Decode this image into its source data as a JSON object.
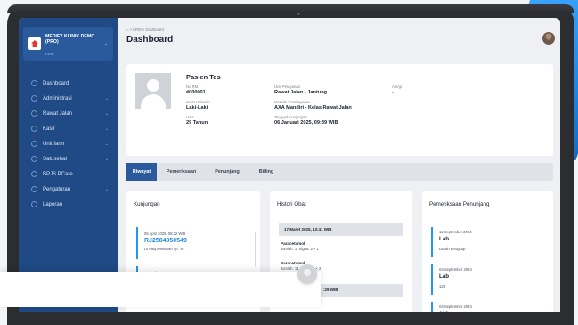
{
  "app": {
    "clinic_name": "MEDIFY KLINIK DEMO (PRO)",
    "clinic_sub": "Klinik"
  },
  "sidebar": {
    "items": [
      {
        "label": "Dashboard",
        "has_children": false
      },
      {
        "label": "Administrasi",
        "has_children": true
      },
      {
        "label": "Rawat Jalan",
        "has_children": true
      },
      {
        "label": "Kasir",
        "has_children": true
      },
      {
        "label": "Unit farm",
        "has_children": true
      },
      {
        "label": "Satusehat",
        "has_children": true
      },
      {
        "label": "BPJS PCare",
        "has_children": true
      },
      {
        "label": "Pengaturan",
        "has_children": true
      },
      {
        "label": "Laporan",
        "has_children": false
      }
    ]
  },
  "header": {
    "breadcrumb": "> ERM > Dashboard",
    "title": "Dashboard"
  },
  "patient": {
    "name": "Pasien Tes",
    "no_rm_label": "No RM",
    "no_rm": "#000001",
    "gender_label": "Jenis Kelamin",
    "gender": "Laki-Laki",
    "age_label": "Usia",
    "age": "29 Tahun",
    "unit_label": "Unit Pelayanan",
    "unit": "Rawat Jalan - Jantung",
    "payment_label": "Metode Pembayaran",
    "payment": "AXA Mandiri - Kelas Rawat Jalan",
    "visit_date_label": "Tanggal Kunjungan",
    "visit_date": "06 Januari 2025, 09:39 WIB",
    "allergy_label": "Alergi",
    "allergy": "-"
  },
  "tabs": [
    {
      "label": "Riwayat",
      "active": true
    },
    {
      "label": "Pemeriksaan",
      "active": false
    },
    {
      "label": "Penunjang",
      "active": false
    },
    {
      "label": "Billing",
      "active": false
    }
  ],
  "kunjungan": {
    "title": "Kunjungan",
    "items": [
      {
        "date": "05 April 2025, 08:22 WIB",
        "no": "RJ2504050549",
        "doctor": "Dr Faiq Aminullah Sp. JP"
      },
      {
        "date": "04 April 2025, 13:41 WIB",
        "no": "",
        "doctor": ""
      }
    ]
  },
  "histori_obat": {
    "title": "Histori Obat",
    "groups": [
      {
        "header": "17 Maret 2025, 13:41 WIB",
        "items": [
          {
            "name": "Paracetamol",
            "dose": "Jumlah: 1, Signa: 2 × 1"
          },
          {
            "name": "Paracetamol",
            "dose": "Jumlah: 14, Signa: 1 × 2"
          }
        ]
      },
      {
        "header": ":29 WIB",
        "items": [
          {
            "name": "",
            "dose": "× 1"
          }
        ]
      }
    ]
  },
  "penunjang": {
    "title": "Pemeriksaan Penunjang",
    "items": [
      {
        "date": "11 September 2024",
        "type": "Lab",
        "desc": "Darah Lengkap"
      },
      {
        "date": "04 September 2024",
        "type": "Lab",
        "desc": "123"
      },
      {
        "date": "04 September 2024",
        "type": "123",
        "desc": ""
      }
    ]
  },
  "colors": {
    "sidebar": "#1f4a86",
    "accent": "#1e88e5",
    "tab_active": "#2a5a9c"
  }
}
